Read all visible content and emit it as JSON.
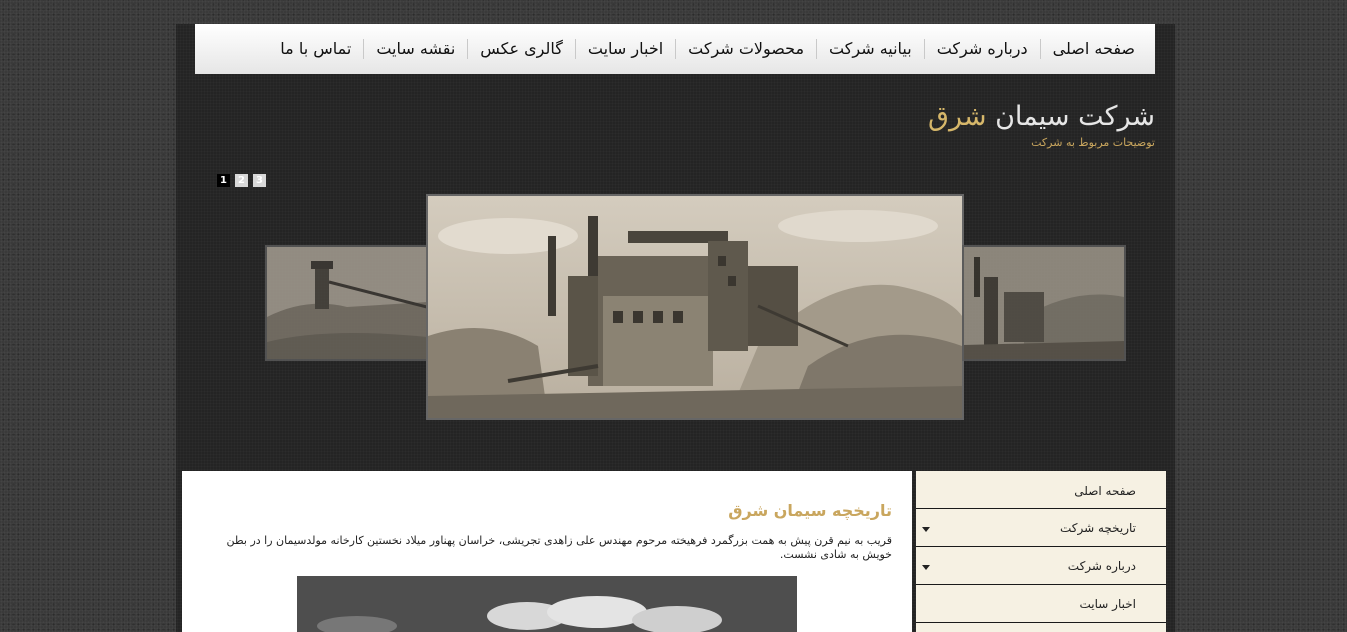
{
  "nav": {
    "items": [
      "صفحه اصلی",
      "درباره شرکت",
      "بیانیه شرکت",
      "محصولات شرکت",
      "اخبار سایت",
      "گالری عکس",
      "نقشه سایت",
      "تماس با ما"
    ]
  },
  "brand": {
    "title_main": "شرکت سیمان ",
    "title_accent": "شرق",
    "tagline": "توضیحات مربوط به شرکت"
  },
  "slider": {
    "pages": [
      "1",
      "2",
      "3"
    ],
    "active_page": "1"
  },
  "content": {
    "title": "تاریخچه سیمان شرق",
    "text": "قریب به نیم قرن پیش به همت بزرگمرد فرهیخته مرحوم مهندس علی زاهدی تجریشی، خراسان پهناور میلاد نخستین کارخانه مولدسیمان را در بطن خویش به شادی نشست."
  },
  "sidebar": {
    "items": [
      {
        "label": "صفحه اصلی",
        "has_submenu": false
      },
      {
        "label": "تاریخچه شرکت",
        "has_submenu": true
      },
      {
        "label": "درباره شرکت",
        "has_submenu": true
      },
      {
        "label": "اخبار سایت",
        "has_submenu": false
      }
    ]
  },
  "colors": {
    "accent": "#d6b76a",
    "background": "#3a3a3a",
    "wrapper": "#242424",
    "sidebar": "#f6f1e3"
  }
}
